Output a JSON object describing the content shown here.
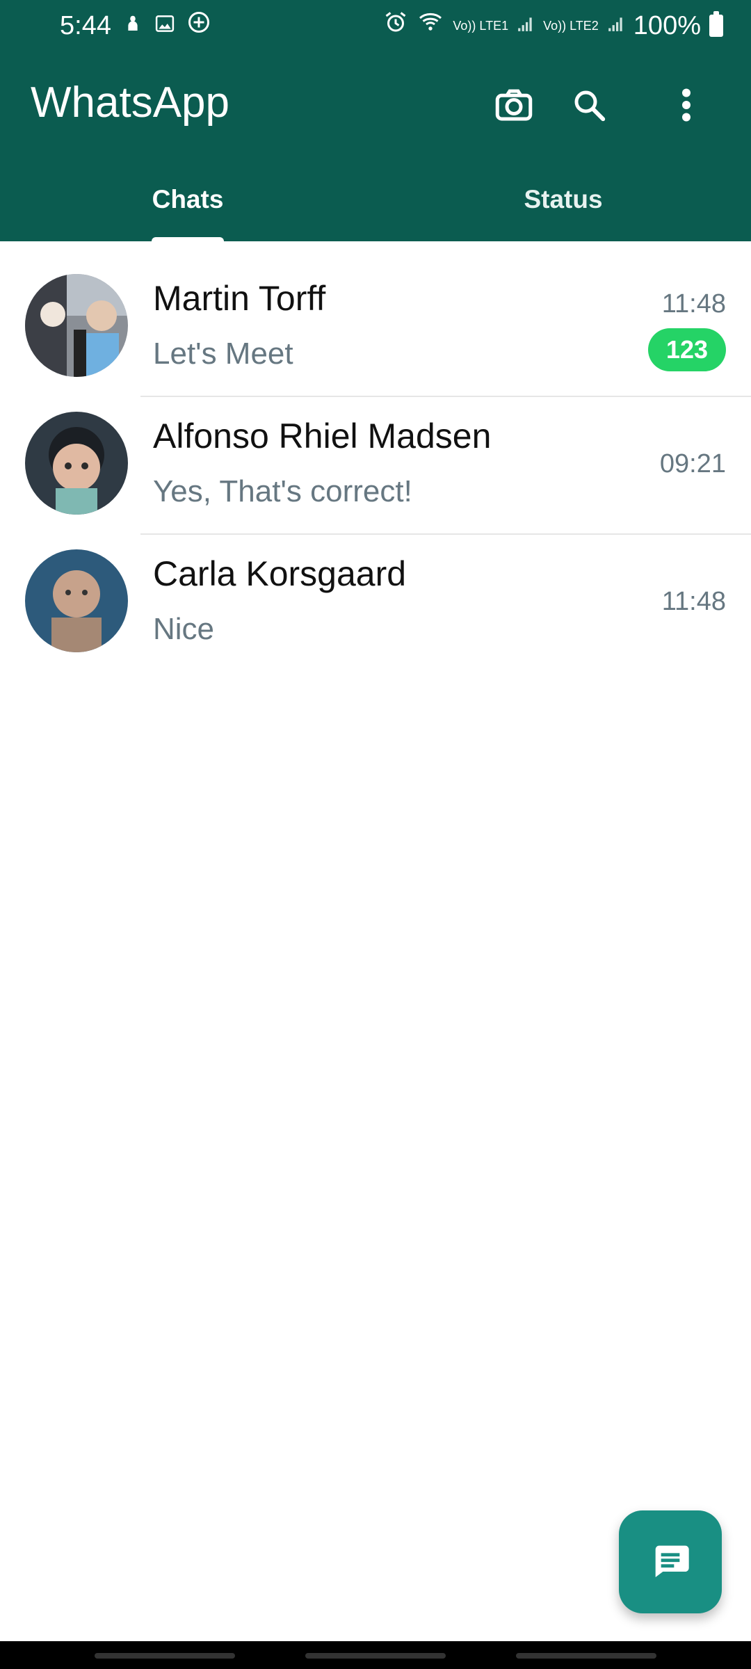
{
  "status_bar": {
    "time": "5:44",
    "left_icons": [
      "notification-icon",
      "image-icon",
      "add-circle-icon"
    ],
    "right": {
      "alarm": "alarm-icon",
      "wifi": "wifi-icon",
      "sim1": "Vo)) LTE1",
      "sim2": "Vo)) LTE2",
      "battery_text": "100%"
    }
  },
  "app_bar": {
    "title": "WhatsApp",
    "icons": [
      "camera-icon",
      "search-icon",
      "more-vert-icon"
    ]
  },
  "tabs": [
    {
      "label": "Chats",
      "selected": true
    },
    {
      "label": "Status",
      "selected": false
    }
  ],
  "chats": [
    {
      "name": "Martin Torff",
      "preview": "Let's Meet",
      "time": "11:48",
      "unread": "123"
    },
    {
      "name": "Alfonso Rhiel Madsen",
      "preview": "Yes, That's correct!",
      "time": "09:21"
    },
    {
      "name": "Carla Korsgaard",
      "preview": "Nice",
      "time": "11:48"
    }
  ],
  "colors": {
    "primary": "#0b5c50",
    "accent": "#25d366",
    "fab": "#198f83",
    "secondary_text": "#667781"
  },
  "fab": {
    "icon": "chat-icon"
  }
}
